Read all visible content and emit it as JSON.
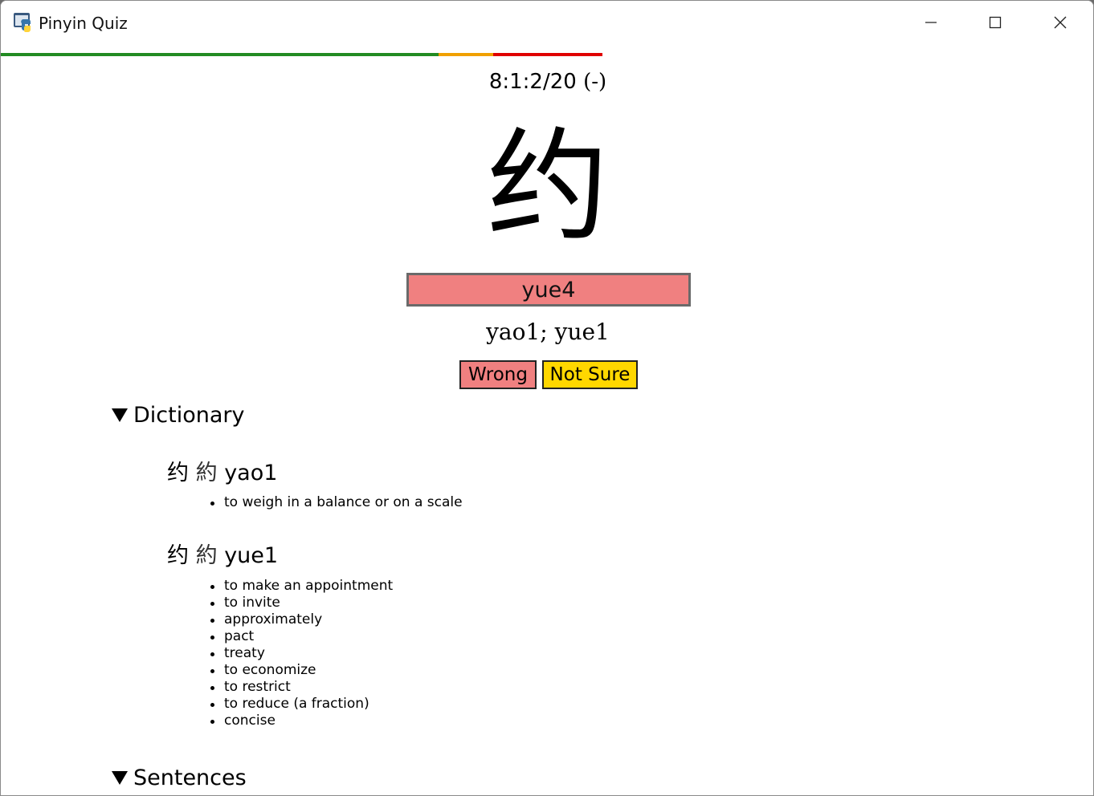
{
  "window": {
    "title": "Pinyin Quiz",
    "icon": "python-icon",
    "controls": [
      "minimize-icon",
      "maximize-icon",
      "close-icon"
    ]
  },
  "progress": {
    "correct_fraction": 0.4,
    "not_sure_fraction": 0.05,
    "wrong_fraction": 0.1,
    "colors": {
      "correct": "#228b22",
      "not_sure": "#f0a000",
      "wrong": "#e00000"
    }
  },
  "quiz": {
    "counter": "8:1:2/20",
    "counter_suffix": "(-)",
    "character": "约",
    "answer_value": "yue4",
    "answer_bg": "#f08080",
    "correct_answer": "yao1; yue1"
  },
  "buttons": {
    "wrong_label": "Wrong",
    "wrong_color": "#f08080",
    "not_sure_label": "Not Sure",
    "not_sure_color": "#ffd700"
  },
  "dictionary": {
    "heading": "Dictionary",
    "entries": [
      {
        "simplified": "约",
        "traditional": "約",
        "pinyin": "yao1",
        "definitions": [
          "to weigh in a balance or on a scale"
        ]
      },
      {
        "simplified": "约",
        "traditional": "約",
        "pinyin": "yue1",
        "definitions": [
          "to make an appointment",
          "to invite",
          "approximately",
          "pact",
          "treaty",
          "to economize",
          "to restrict",
          "to reduce (a fraction)",
          "concise"
        ]
      }
    ]
  },
  "sentences": {
    "heading": "Sentences"
  }
}
